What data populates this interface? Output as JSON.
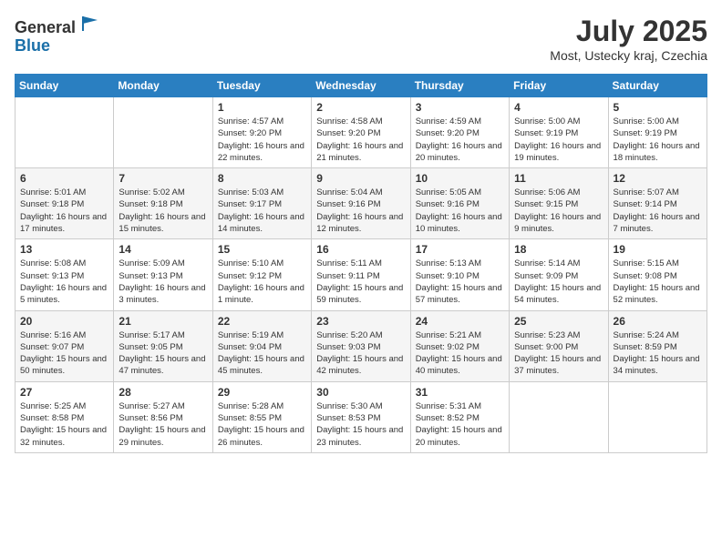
{
  "header": {
    "logo_general": "General",
    "logo_blue": "Blue",
    "month": "July 2025",
    "location": "Most, Ustecky kraj, Czechia"
  },
  "weekdays": [
    "Sunday",
    "Monday",
    "Tuesday",
    "Wednesday",
    "Thursday",
    "Friday",
    "Saturday"
  ],
  "weeks": [
    [
      {
        "day": "",
        "sunrise": "",
        "sunset": "",
        "daylight": ""
      },
      {
        "day": "",
        "sunrise": "",
        "sunset": "",
        "daylight": ""
      },
      {
        "day": "1",
        "sunrise": "Sunrise: 4:57 AM",
        "sunset": "Sunset: 9:20 PM",
        "daylight": "Daylight: 16 hours and 22 minutes."
      },
      {
        "day": "2",
        "sunrise": "Sunrise: 4:58 AM",
        "sunset": "Sunset: 9:20 PM",
        "daylight": "Daylight: 16 hours and 21 minutes."
      },
      {
        "day": "3",
        "sunrise": "Sunrise: 4:59 AM",
        "sunset": "Sunset: 9:20 PM",
        "daylight": "Daylight: 16 hours and 20 minutes."
      },
      {
        "day": "4",
        "sunrise": "Sunrise: 5:00 AM",
        "sunset": "Sunset: 9:19 PM",
        "daylight": "Daylight: 16 hours and 19 minutes."
      },
      {
        "day": "5",
        "sunrise": "Sunrise: 5:00 AM",
        "sunset": "Sunset: 9:19 PM",
        "daylight": "Daylight: 16 hours and 18 minutes."
      }
    ],
    [
      {
        "day": "6",
        "sunrise": "Sunrise: 5:01 AM",
        "sunset": "Sunset: 9:18 PM",
        "daylight": "Daylight: 16 hours and 17 minutes."
      },
      {
        "day": "7",
        "sunrise": "Sunrise: 5:02 AM",
        "sunset": "Sunset: 9:18 PM",
        "daylight": "Daylight: 16 hours and 15 minutes."
      },
      {
        "day": "8",
        "sunrise": "Sunrise: 5:03 AM",
        "sunset": "Sunset: 9:17 PM",
        "daylight": "Daylight: 16 hours and 14 minutes."
      },
      {
        "day": "9",
        "sunrise": "Sunrise: 5:04 AM",
        "sunset": "Sunset: 9:16 PM",
        "daylight": "Daylight: 16 hours and 12 minutes."
      },
      {
        "day": "10",
        "sunrise": "Sunrise: 5:05 AM",
        "sunset": "Sunset: 9:16 PM",
        "daylight": "Daylight: 16 hours and 10 minutes."
      },
      {
        "day": "11",
        "sunrise": "Sunrise: 5:06 AM",
        "sunset": "Sunset: 9:15 PM",
        "daylight": "Daylight: 16 hours and 9 minutes."
      },
      {
        "day": "12",
        "sunrise": "Sunrise: 5:07 AM",
        "sunset": "Sunset: 9:14 PM",
        "daylight": "Daylight: 16 hours and 7 minutes."
      }
    ],
    [
      {
        "day": "13",
        "sunrise": "Sunrise: 5:08 AM",
        "sunset": "Sunset: 9:13 PM",
        "daylight": "Daylight: 16 hours and 5 minutes."
      },
      {
        "day": "14",
        "sunrise": "Sunrise: 5:09 AM",
        "sunset": "Sunset: 9:13 PM",
        "daylight": "Daylight: 16 hours and 3 minutes."
      },
      {
        "day": "15",
        "sunrise": "Sunrise: 5:10 AM",
        "sunset": "Sunset: 9:12 PM",
        "daylight": "Daylight: 16 hours and 1 minute."
      },
      {
        "day": "16",
        "sunrise": "Sunrise: 5:11 AM",
        "sunset": "Sunset: 9:11 PM",
        "daylight": "Daylight: 15 hours and 59 minutes."
      },
      {
        "day": "17",
        "sunrise": "Sunrise: 5:13 AM",
        "sunset": "Sunset: 9:10 PM",
        "daylight": "Daylight: 15 hours and 57 minutes."
      },
      {
        "day": "18",
        "sunrise": "Sunrise: 5:14 AM",
        "sunset": "Sunset: 9:09 PM",
        "daylight": "Daylight: 15 hours and 54 minutes."
      },
      {
        "day": "19",
        "sunrise": "Sunrise: 5:15 AM",
        "sunset": "Sunset: 9:08 PM",
        "daylight": "Daylight: 15 hours and 52 minutes."
      }
    ],
    [
      {
        "day": "20",
        "sunrise": "Sunrise: 5:16 AM",
        "sunset": "Sunset: 9:07 PM",
        "daylight": "Daylight: 15 hours and 50 minutes."
      },
      {
        "day": "21",
        "sunrise": "Sunrise: 5:17 AM",
        "sunset": "Sunset: 9:05 PM",
        "daylight": "Daylight: 15 hours and 47 minutes."
      },
      {
        "day": "22",
        "sunrise": "Sunrise: 5:19 AM",
        "sunset": "Sunset: 9:04 PM",
        "daylight": "Daylight: 15 hours and 45 minutes."
      },
      {
        "day": "23",
        "sunrise": "Sunrise: 5:20 AM",
        "sunset": "Sunset: 9:03 PM",
        "daylight": "Daylight: 15 hours and 42 minutes."
      },
      {
        "day": "24",
        "sunrise": "Sunrise: 5:21 AM",
        "sunset": "Sunset: 9:02 PM",
        "daylight": "Daylight: 15 hours and 40 minutes."
      },
      {
        "day": "25",
        "sunrise": "Sunrise: 5:23 AM",
        "sunset": "Sunset: 9:00 PM",
        "daylight": "Daylight: 15 hours and 37 minutes."
      },
      {
        "day": "26",
        "sunrise": "Sunrise: 5:24 AM",
        "sunset": "Sunset: 8:59 PM",
        "daylight": "Daylight: 15 hours and 34 minutes."
      }
    ],
    [
      {
        "day": "27",
        "sunrise": "Sunrise: 5:25 AM",
        "sunset": "Sunset: 8:58 PM",
        "daylight": "Daylight: 15 hours and 32 minutes."
      },
      {
        "day": "28",
        "sunrise": "Sunrise: 5:27 AM",
        "sunset": "Sunset: 8:56 PM",
        "daylight": "Daylight: 15 hours and 29 minutes."
      },
      {
        "day": "29",
        "sunrise": "Sunrise: 5:28 AM",
        "sunset": "Sunset: 8:55 PM",
        "daylight": "Daylight: 15 hours and 26 minutes."
      },
      {
        "day": "30",
        "sunrise": "Sunrise: 5:30 AM",
        "sunset": "Sunset: 8:53 PM",
        "daylight": "Daylight: 15 hours and 23 minutes."
      },
      {
        "day": "31",
        "sunrise": "Sunrise: 5:31 AM",
        "sunset": "Sunset: 8:52 PM",
        "daylight": "Daylight: 15 hours and 20 minutes."
      },
      {
        "day": "",
        "sunrise": "",
        "sunset": "",
        "daylight": ""
      },
      {
        "day": "",
        "sunrise": "",
        "sunset": "",
        "daylight": ""
      }
    ]
  ]
}
